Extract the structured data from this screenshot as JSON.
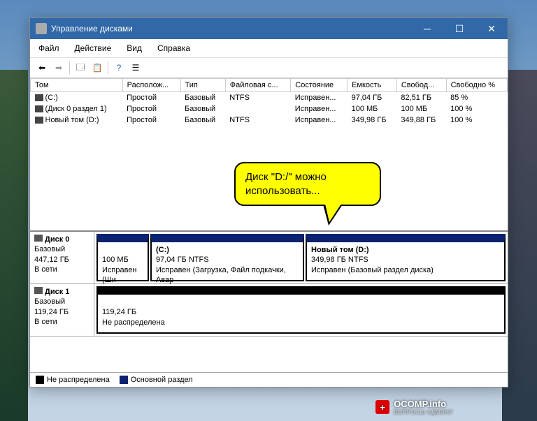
{
  "window": {
    "title": "Управление дисками"
  },
  "menu": {
    "file": "Файл",
    "action": "Действие",
    "view": "Вид",
    "help": "Справка"
  },
  "columns": {
    "volume": "Том",
    "layout": "Располож...",
    "type": "Тип",
    "fs": "Файловая с...",
    "status": "Состояние",
    "capacity": "Емкость",
    "free": "Свобод...",
    "freepct": "Свободно %"
  },
  "rows": [
    {
      "vol": "(C:)",
      "layout": "Простой",
      "type": "Базовый",
      "fs": "NTFS",
      "status": "Исправен...",
      "cap": "97,04 ГБ",
      "free": "82,51 ГБ",
      "pct": "85 %"
    },
    {
      "vol": "(Диск 0 раздел 1)",
      "layout": "Простой",
      "type": "Базовый",
      "fs": "",
      "status": "Исправен...",
      "cap": "100 МБ",
      "free": "100 МБ",
      "pct": "100 %"
    },
    {
      "vol": "Новый том (D:)",
      "layout": "Простой",
      "type": "Базовый",
      "fs": "NTFS",
      "status": "Исправен...",
      "cap": "349,98 ГБ",
      "free": "349,88 ГБ",
      "pct": "100 %"
    }
  ],
  "disk0": {
    "name": "Диск 0",
    "type": "Базовый",
    "size": "447,12 ГБ",
    "state": "В сети",
    "p1_size": "100 МБ",
    "p1_status": "Исправен (Ши",
    "p2_name": "(C:)",
    "p2_size": "97,04 ГБ NTFS",
    "p2_status": "Исправен (Загрузка, Файл подкачки, Авар",
    "p3_name": "Новый том  (D:)",
    "p3_size": "349,98 ГБ NTFS",
    "p3_status": "Исправен (Базовый раздел диска)"
  },
  "disk1": {
    "name": "Диск 1",
    "type": "Базовый",
    "size": "119,24 ГБ",
    "state": "В сети",
    "p1_size": "119,24 ГБ",
    "p1_status": "Не распределена"
  },
  "legend": {
    "unalloc": "Не распределена",
    "primary": "Основной раздел"
  },
  "callout": {
    "text": "Диск \"D:/\" можно использовать..."
  },
  "watermark": {
    "name": "OCOMP.info",
    "sub": "ВОПРОСЫ АДМИНУ",
    "plus": "+"
  }
}
